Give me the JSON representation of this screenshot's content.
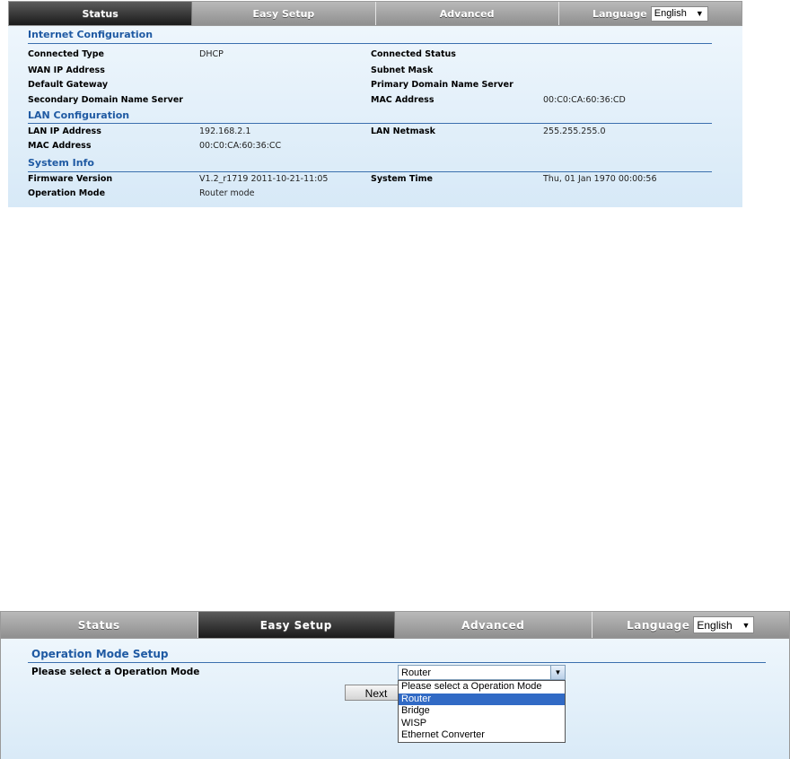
{
  "status_screen": {
    "nav": {
      "tabs": [
        "Status",
        "Easy Setup",
        "Advanced"
      ],
      "active_tab": "Status",
      "language_label": "Language",
      "language_value": "English"
    },
    "internet": {
      "title": "Internet Configuration",
      "connected_type_label": "Connected Type",
      "connected_type_value": "DHCP",
      "connected_status_label": "Connected Status",
      "wan_ip_label": "WAN IP Address",
      "subnet_mask_label": "Subnet Mask",
      "default_gateway_label": "Default Gateway",
      "primary_dns_label": "Primary Domain Name Server",
      "secondary_dns_label": "Secondary Domain Name Server",
      "mac_label": "MAC Address",
      "mac_value": "00:C0:CA:60:36:CD"
    },
    "lan": {
      "title": "LAN Configuration",
      "ip_label": "LAN IP Address",
      "ip_value": "192.168.2.1",
      "netmask_label": "LAN Netmask",
      "netmask_value": "255.255.255.0",
      "mac_label": "MAC Address",
      "mac_value": "00:C0:CA:60:36:CC"
    },
    "system": {
      "title": "System Info",
      "firmware_label": "Firmware Version",
      "firmware_value": "V1.2_r1719 2011-10-21-11:05",
      "time_label": "System Time",
      "time_value": "Thu, 01 Jan 1970 00:00:56",
      "mode_label": "Operation Mode",
      "mode_value": "Router mode"
    }
  },
  "setup_screen": {
    "nav": {
      "tabs": [
        "Status",
        "Easy Setup",
        "Advanced"
      ],
      "active_tab": "Easy Setup",
      "language_label": "Language",
      "language_value": "English"
    },
    "title": "Operation Mode Setup",
    "prompt": "Please select a Operation Mode",
    "selected_mode": "Router",
    "next_label": "Next",
    "options": [
      "Please select a Operation Mode",
      "Router",
      "Bridge",
      "WISP",
      "Ethernet Converter"
    ],
    "highlighted_option": "Router"
  },
  "colors": {
    "section_title": "#1f5aa3",
    "active_tab": "#2a2a2a",
    "inactive_tab": "#a5a5a5",
    "panel_bg": "#e3f0fa",
    "option_highlight": "#316ac5"
  }
}
